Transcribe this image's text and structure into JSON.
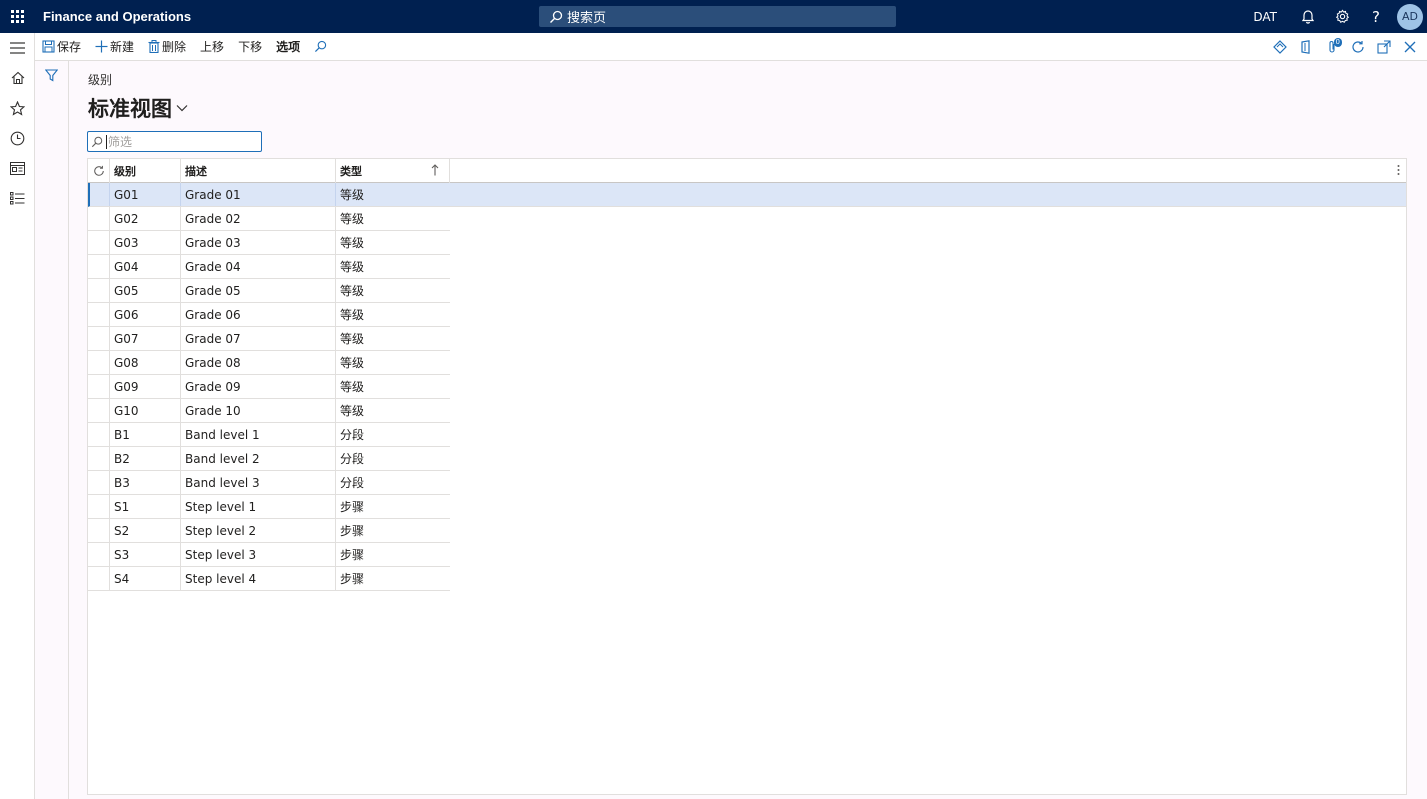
{
  "app": {
    "title": "Finance and Operations"
  },
  "search": {
    "placeholder": "搜索页"
  },
  "topbar": {
    "company": "DAT",
    "avatar_initials": "AD"
  },
  "actions": {
    "save": "保存",
    "new": "新建",
    "delete": "删除",
    "move_up": "上移",
    "move_down": "下移",
    "options": "选项",
    "notification_count": "0"
  },
  "page": {
    "breadcrumb": "级别",
    "view_name": "标准视图",
    "filter_placeholder": "筛选"
  },
  "grid": {
    "columns": [
      "级别",
      "描述",
      "类型"
    ],
    "rows": [
      {
        "level": "G01",
        "description": "Grade 01",
        "type": "等级",
        "selected": true
      },
      {
        "level": "G02",
        "description": "Grade 02",
        "type": "等级"
      },
      {
        "level": "G03",
        "description": "Grade 03",
        "type": "等级"
      },
      {
        "level": "G04",
        "description": "Grade 04",
        "type": "等级"
      },
      {
        "level": "G05",
        "description": "Grade 05",
        "type": "等级"
      },
      {
        "level": "G06",
        "description": "Grade 06",
        "type": "等级"
      },
      {
        "level": "G07",
        "description": "Grade 07",
        "type": "等级"
      },
      {
        "level": "G08",
        "description": "Grade 08",
        "type": "等级"
      },
      {
        "level": "G09",
        "description": "Grade 09",
        "type": "等级"
      },
      {
        "level": "G10",
        "description": "Grade 10",
        "type": "等级"
      },
      {
        "level": "B1",
        "description": "Band level 1",
        "type": "分段"
      },
      {
        "level": "B2",
        "description": "Band level 2",
        "type": "分段"
      },
      {
        "level": "B3",
        "description": "Band level 3",
        "type": "分段"
      },
      {
        "level": "S1",
        "description": "Step level 1",
        "type": "步骤"
      },
      {
        "level": "S2",
        "description": "Step level 2",
        "type": "步骤"
      },
      {
        "level": "S3",
        "description": "Step level 3",
        "type": "步骤"
      },
      {
        "level": "S4",
        "description": "Step level 4",
        "type": "步骤"
      }
    ]
  },
  "colors": {
    "topbar": "#002050",
    "accent": "#1f6fb8",
    "selected_row": "#dce6f7"
  }
}
